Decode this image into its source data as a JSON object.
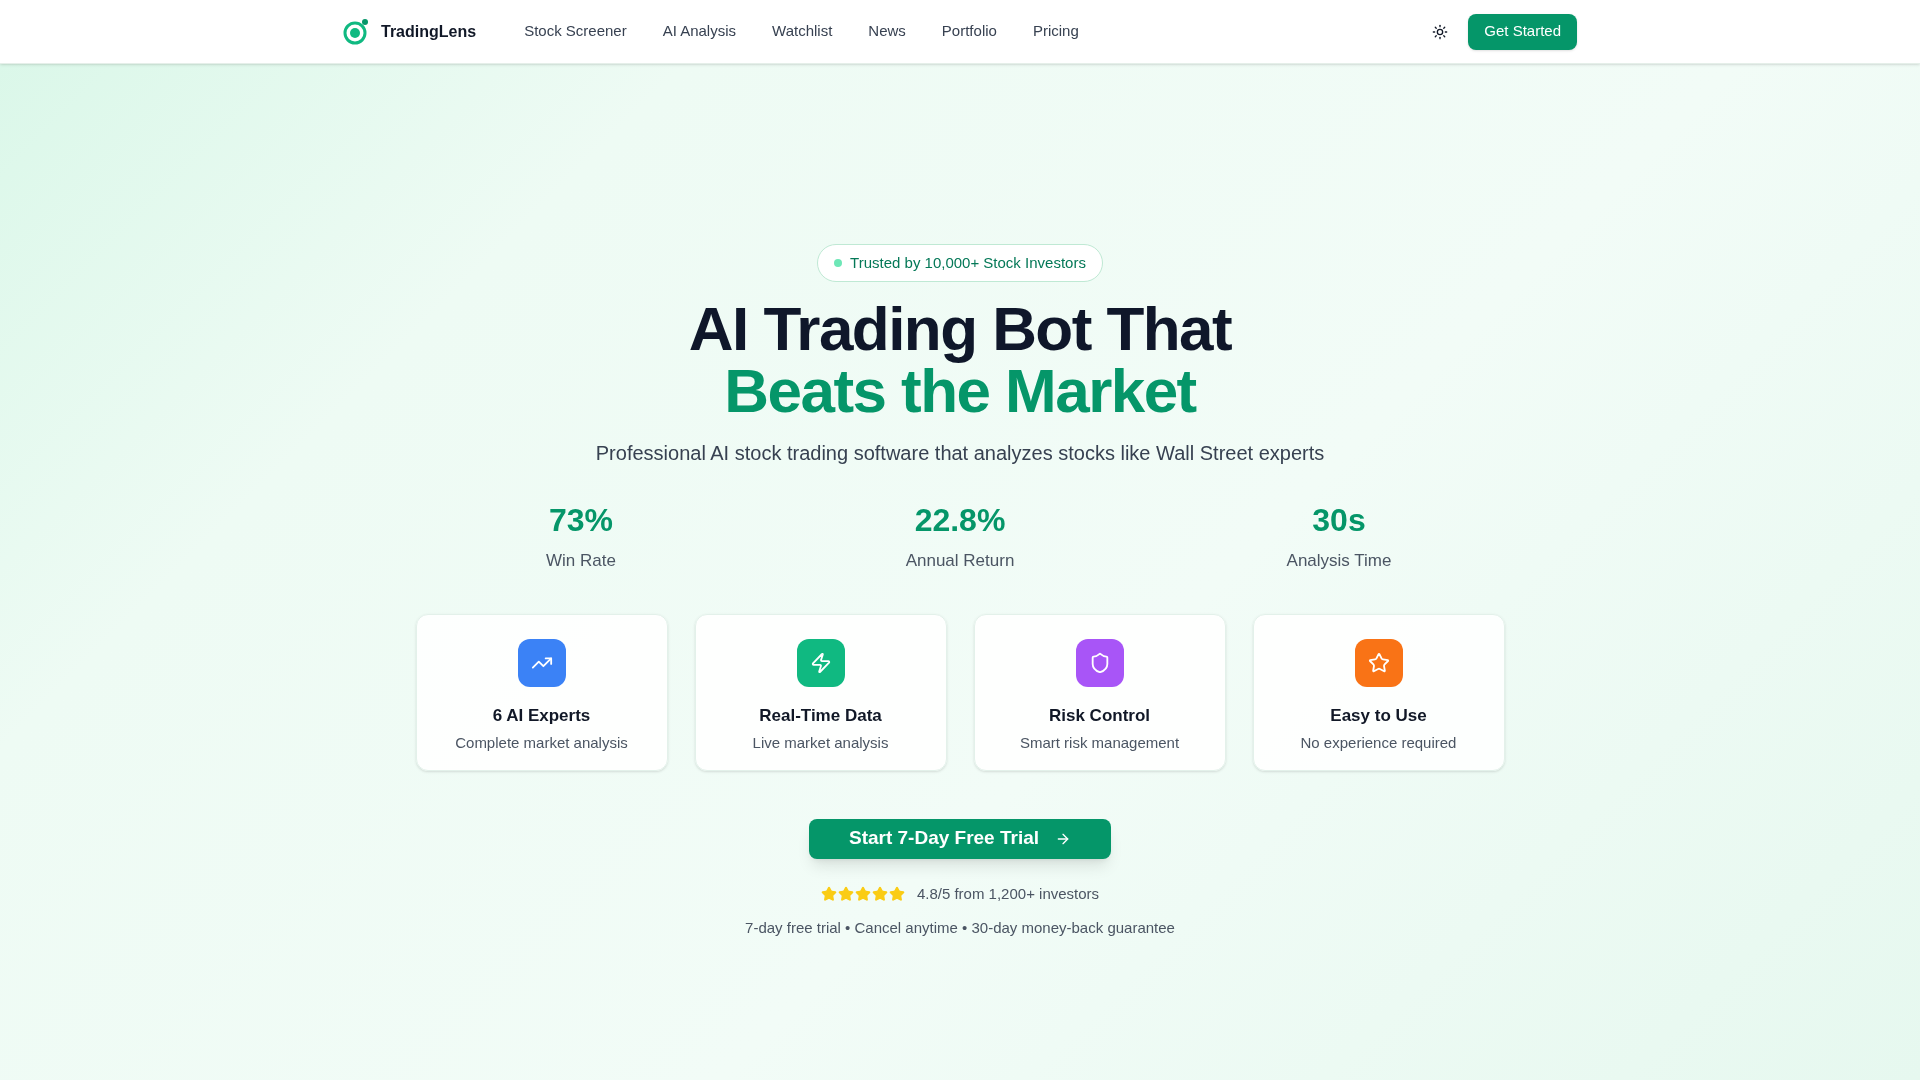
{
  "nav": {
    "brand": "TradingLens",
    "links": [
      "Stock Screener",
      "AI Analysis",
      "Watchlist",
      "News",
      "Portfolio",
      "Pricing"
    ],
    "cta": "Get Started"
  },
  "hero": {
    "badge": "Trusted by 10,000+ Stock Investors",
    "title_line1": "AI Trading Bot That",
    "title_line2": "Beats the Market",
    "subtitle": "Professional AI stock trading software that analyzes stocks like Wall Street experts"
  },
  "stats": [
    {
      "value": "73%",
      "label": "Win Rate"
    },
    {
      "value": "22.8%",
      "label": "Annual Return"
    },
    {
      "value": "30s",
      "label": "Analysis Time"
    }
  ],
  "features": [
    {
      "kind": "trend",
      "color": "#3b82f6",
      "title": "6 AI Experts",
      "description": "Complete market analysis"
    },
    {
      "kind": "bolt",
      "color": "#10b981",
      "title": "Real-Time Data",
      "description": "Live market analysis"
    },
    {
      "kind": "shield",
      "color": "#a855f7",
      "title": "Risk Control",
      "description": "Smart risk management"
    },
    {
      "kind": "star",
      "color": "#f97316",
      "title": "Easy to Use",
      "description": "No experience required"
    }
  ],
  "cta": {
    "button": "Start 7-Day Free Trial",
    "stars": 5,
    "rating": "4.8/5 from 1,200+ investors",
    "guarantee": "7-day free trial • Cancel anytime • 30-day money-back guarantee"
  }
}
